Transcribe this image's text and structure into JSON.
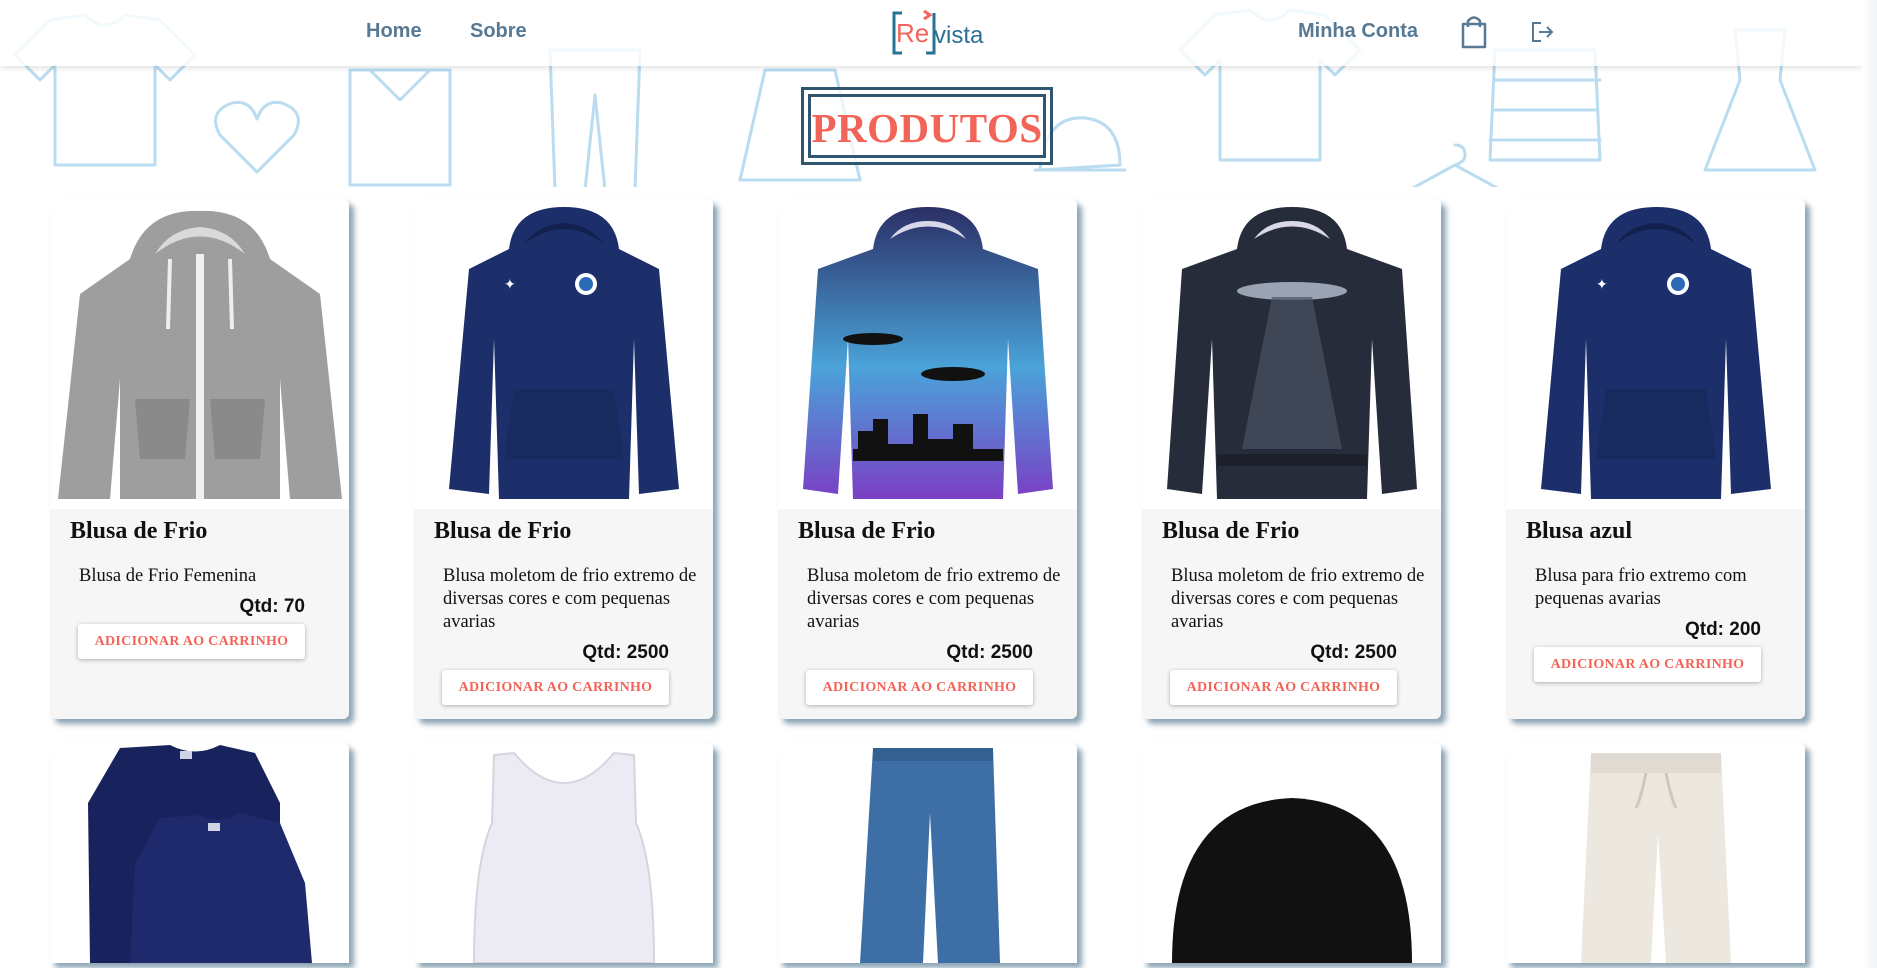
{
  "header": {
    "nav": {
      "home": "Home",
      "about": "Sobre"
    },
    "logo": {
      "part1": "Re",
      "part2": "vista"
    },
    "account": "Minha Conta",
    "icons": {
      "cart": "shopping-bag-icon",
      "logout": "logout-icon"
    }
  },
  "page_title": "PRODUTOS",
  "products": [
    {
      "name": "Blusa de Frio",
      "description": "Blusa de Frio Femenina",
      "qty": "Qtd: 70",
      "button": "ADICIONAR AO CARRINHO"
    },
    {
      "name": "Blusa de Frio",
      "description": "Blusa moletom de frio extremo de diversas cores e com pequenas avarias",
      "qty": "Qtd: 2500",
      "button": "ADICIONAR AO CARRINHO"
    },
    {
      "name": "Blusa de Frio",
      "description": "Blusa moletom de frio extremo de diversas cores e com pequenas avarias",
      "qty": "Qtd: 2500",
      "button": "ADICIONAR AO CARRINHO"
    },
    {
      "name": "Blusa de Frio",
      "description": "Blusa moletom de frio extremo de diversas cores e com pequenas avarias",
      "qty": "Qtd: 2500",
      "button": "ADICIONAR AO CARRINHO"
    },
    {
      "name": "Blusa azul",
      "description": "Blusa para frio extremo com pequenas avarias",
      "qty": "Qtd: 200",
      "button": "ADICIONAR AO CARRINHO"
    }
  ],
  "colors": {
    "accent": "#f26457",
    "nav_text": "#577993",
    "title_border": "#30566f",
    "background_doodles": "#b9dcf1"
  }
}
